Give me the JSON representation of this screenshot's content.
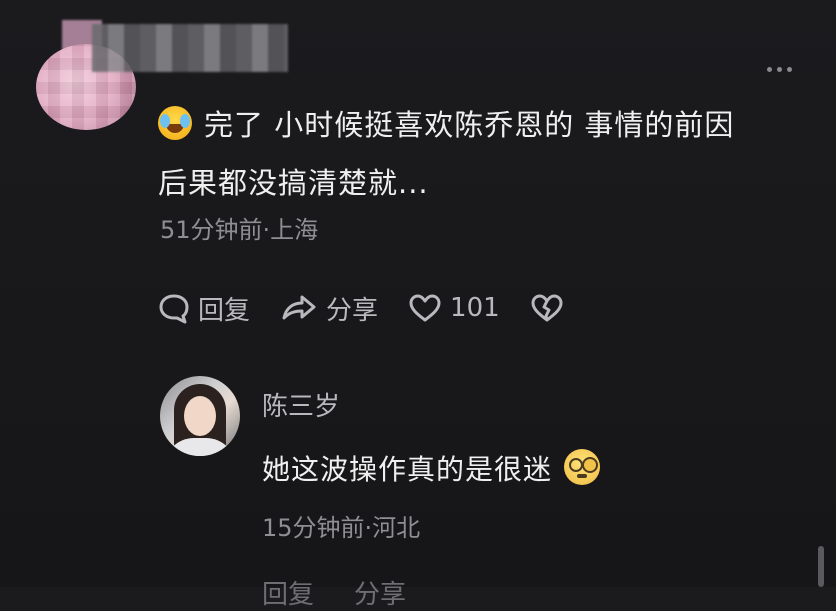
{
  "comment": {
    "text_line1": "完了 小时候挺喜欢陈乔恩的 事情的前因",
    "text_line2": "后果都没搞清楚就...",
    "meta": "51分钟前·上海",
    "emoji": "laughing-crying-emoji",
    "actions": {
      "reply_label": "回复",
      "share_label": "分享",
      "like_count": "101"
    }
  },
  "reply": {
    "author": "陈三岁",
    "text": "她这波操作真的是很迷",
    "emoji": "dizzy-face-emoji",
    "meta": "15分钟前·河北",
    "actions": {
      "reply_label": "回复",
      "share_label": "分享"
    }
  },
  "colors": {
    "background": "#1a1a1c",
    "text_primary": "#efefef",
    "text_secondary": "#8e8e93"
  }
}
